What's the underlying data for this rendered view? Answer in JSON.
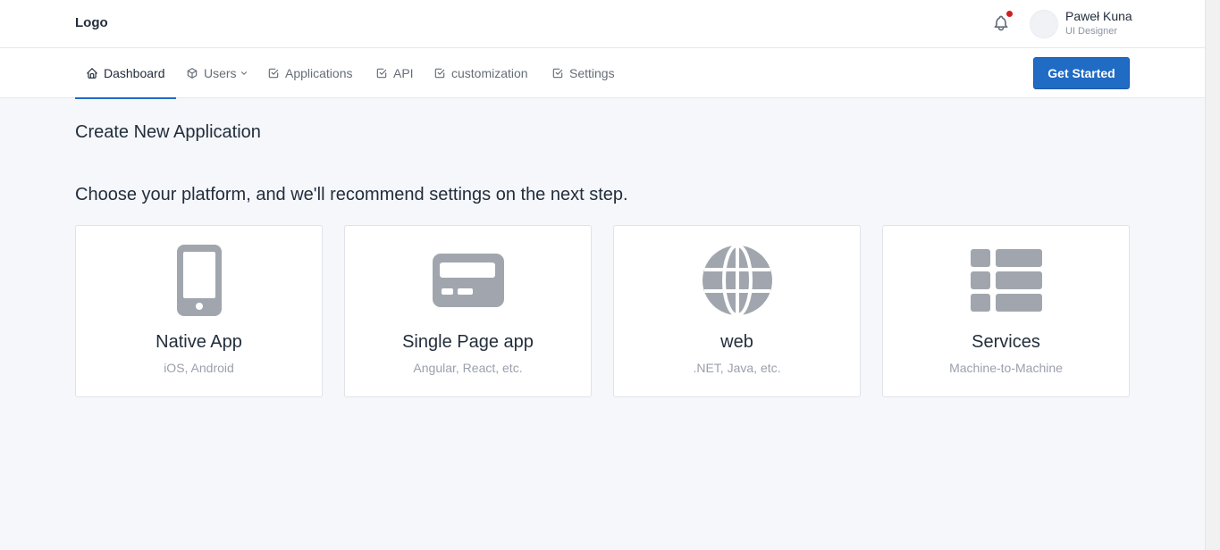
{
  "header": {
    "logo": "Logo",
    "user": {
      "name": "Paweł Kuna",
      "role": "UI Designer"
    }
  },
  "nav": {
    "items": [
      {
        "label": "Dashboard",
        "icon": "home-icon",
        "active": true
      },
      {
        "label": "Users",
        "icon": "package-icon",
        "dropdown": true
      },
      {
        "label": "Applications",
        "icon": "checkbox-icon"
      },
      {
        "label": "API",
        "icon": "checkbox-icon"
      },
      {
        "label": "customization",
        "icon": "checkbox-icon"
      },
      {
        "label": "Settings",
        "icon": "checkbox-icon"
      }
    ],
    "cta_label": "Get Started"
  },
  "main": {
    "title": "Create New Application",
    "subtitle": "Choose your platform, and we'll recommend settings on the next step.",
    "cards": [
      {
        "title": "Native App",
        "subtitle": "iOS, Android",
        "icon": "mobile-phone-icon"
      },
      {
        "title": "Single Page app",
        "subtitle": "Angular, React, etc.",
        "icon": "browser-window-icon"
      },
      {
        "title": "web",
        "subtitle": ".NET, Java, etc.",
        "icon": "globe-icon"
      },
      {
        "title": "Services",
        "subtitle": "Machine-to-Machine",
        "icon": "table-list-icon"
      }
    ]
  },
  "colors": {
    "accent": "#206bc4",
    "background": "#f5f7fb",
    "icon_gray": "#a1a6ae",
    "notification_dot": "#cd201f"
  }
}
